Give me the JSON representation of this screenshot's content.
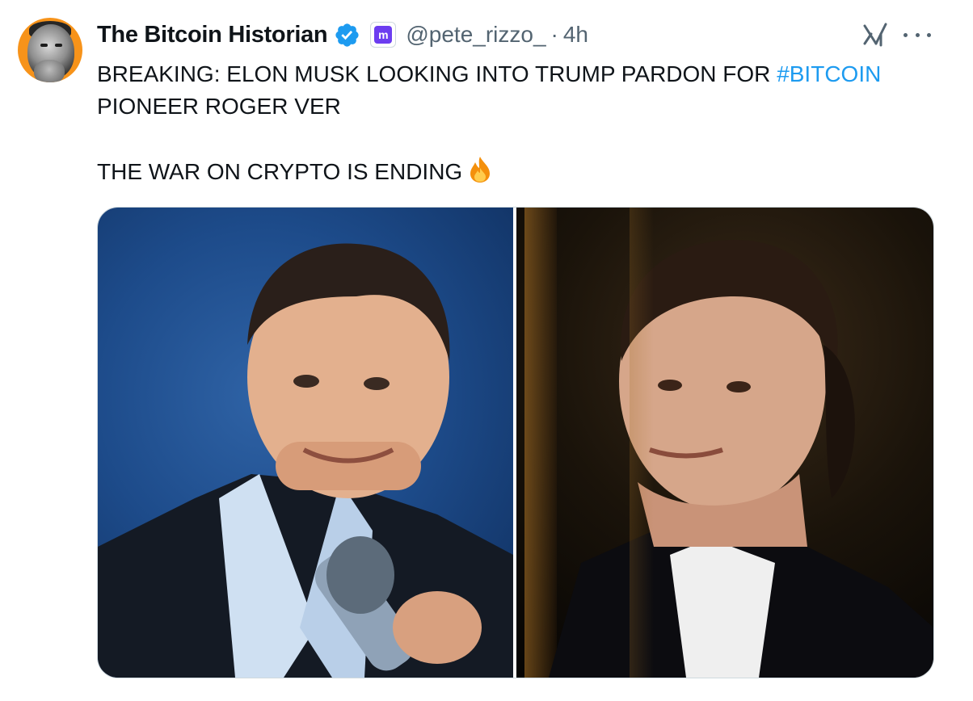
{
  "tweet": {
    "author": {
      "display_name": "The Bitcoin Historian",
      "handle": "@pete_rizzo_",
      "separator": "·",
      "time": "4h",
      "verified_icon": "verified-badge-icon",
      "affiliate_icon": "kraken-affiliate-icon",
      "affiliate_glyph": "m",
      "avatar_bg": "#f7931a"
    },
    "text": {
      "line1_prefix": "BREAKING: ELON MUSK LOOKING INTO TRUMP PARDON FOR ",
      "hashtag": "#BITCOIN",
      "line1_suffix": " PIONEER ROGER VER",
      "line2": "THE WAR ON CRYPTO IS ENDING",
      "emoji": "fire-icon"
    },
    "actions": {
      "grok_icon": "grok-icon",
      "more_icon": "more-options-icon"
    },
    "media": [
      {
        "subject": "man-with-microphone",
        "bg": "#1d4b8a"
      },
      {
        "subject": "man-in-dark-jacket",
        "bg": "#120d07"
      }
    ],
    "colors": {
      "text": "#0f1419",
      "secondary": "#536471",
      "link": "#1d9bf0",
      "verified": "#1d9bf0",
      "affiliate": "#6c3df0"
    }
  }
}
